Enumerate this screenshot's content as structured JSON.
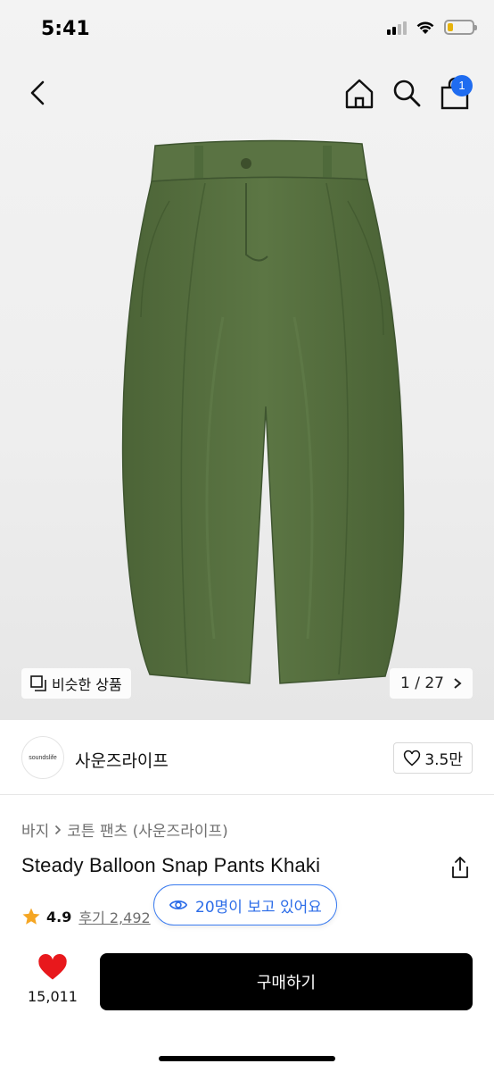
{
  "status_bar": {
    "time": "5:41"
  },
  "nav": {
    "cart_count": "1"
  },
  "gallery": {
    "similar_label": "비슷한 상품",
    "page_counter": "1 / 27"
  },
  "brand": {
    "logo_text": "soundslife",
    "name": "사운즈라이프",
    "likes": "3.5만"
  },
  "breadcrumb": [
    "바지",
    "코튼 팬츠 (사운즈라이프)"
  ],
  "product": {
    "title": "Steady Balloon Snap Pants Khaki",
    "rating": "4.9",
    "reviews": "후기 2,492"
  },
  "viewing": {
    "text": "20명이 보고 있어요"
  },
  "bottom": {
    "favorite_count": "15,011",
    "buy_label": "구매하기"
  },
  "colors": {
    "accent_blue": "#1f6cf0",
    "heart_red": "#e8181c",
    "star": "#f5a623",
    "pants_khaki": "#56703f"
  }
}
